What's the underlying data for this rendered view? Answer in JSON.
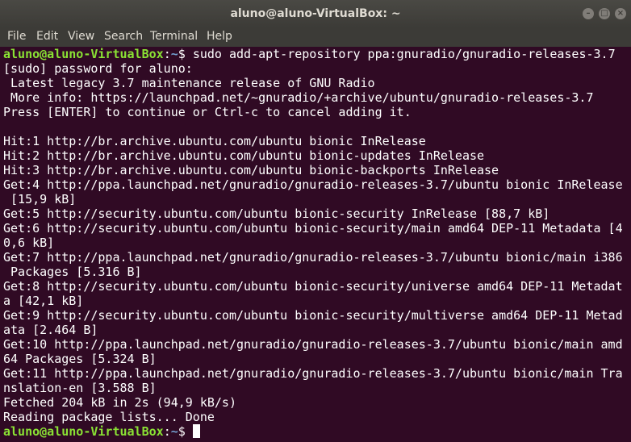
{
  "window": {
    "title": "aluno@aluno-VirtualBox: ~",
    "minimize_glyph": "–",
    "maximize_glyph": "□",
    "close_glyph": "×"
  },
  "menu": {
    "items": [
      {
        "label": "File"
      },
      {
        "label": "Edit"
      },
      {
        "label": "View"
      },
      {
        "label": "Search"
      },
      {
        "label": "Terminal"
      },
      {
        "label": "Help"
      }
    ]
  },
  "prompt": {
    "user_host": "aluno@aluno-VirtualBox",
    "separator": ":",
    "path": "~",
    "symbol": "$ "
  },
  "terminal": {
    "command": "sudo add-apt-repository ppa:gnuradio/gnuradio-releases-3.7",
    "lines": [
      "[sudo] password for aluno:",
      " Latest legacy 3.7 maintenance release of GNU Radio",
      " More info: https://launchpad.net/~gnuradio/+archive/ubuntu/gnuradio-releases-3.7",
      "Press [ENTER] to continue or Ctrl-c to cancel adding it.",
      "",
      "Hit:1 http://br.archive.ubuntu.com/ubuntu bionic InRelease",
      "Hit:2 http://br.archive.ubuntu.com/ubuntu bionic-updates InRelease",
      "Hit:3 http://br.archive.ubuntu.com/ubuntu bionic-backports InRelease",
      "Get:4 http://ppa.launchpad.net/gnuradio/gnuradio-releases-3.7/ubuntu bionic InRelease",
      " [15,9 kB]",
      "Get:5 http://security.ubuntu.com/ubuntu bionic-security InRelease [88,7 kB]",
      "Get:6 http://security.ubuntu.com/ubuntu bionic-security/main amd64 DEP-11 Metadata [4",
      "0,6 kB]",
      "Get:7 http://ppa.launchpad.net/gnuradio/gnuradio-releases-3.7/ubuntu bionic/main i386",
      " Packages [5.316 B]",
      "Get:8 http://security.ubuntu.com/ubuntu bionic-security/universe amd64 DEP-11 Metadat",
      "a [42,1 kB]",
      "Get:9 http://security.ubuntu.com/ubuntu bionic-security/multiverse amd64 DEP-11 Metad",
      "ata [2.464 B]",
      "Get:10 http://ppa.launchpad.net/gnuradio/gnuradio-releases-3.7/ubuntu bionic/main amd",
      "64 Packages [5.324 B]",
      "Get:11 http://ppa.launchpad.net/gnuradio/gnuradio-releases-3.7/ubuntu bionic/main Tra",
      "nslation-en [3.588 B]",
      "Fetched 204 kB in 2s (94,9 kB/s)",
      "Reading package lists... Done"
    ]
  },
  "colors": {
    "background": "#300a24",
    "prompt_user": "#8ae234",
    "prompt_path": "#729fcf",
    "text": "#ffffff",
    "titlebar": "#3c3b37"
  }
}
